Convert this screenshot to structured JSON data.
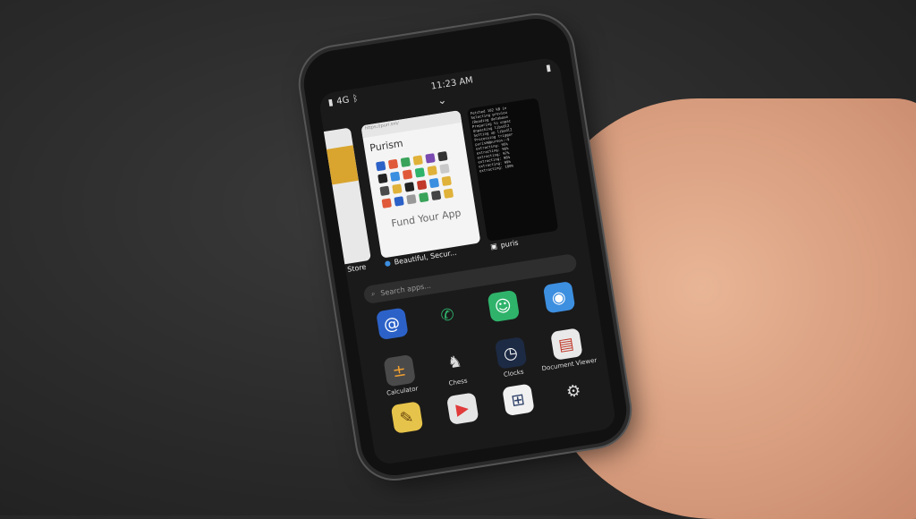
{
  "status": {
    "signal": "4G",
    "time": "11:23 AM"
  },
  "switcher": {
    "left_card_caption": "Store",
    "middle_card": {
      "url": "https://puri.sm/",
      "brand": "Purism",
      "headline": "Fund Your App",
      "title": "Beautiful, Secur..."
    },
    "right_card": {
      "title": "puris",
      "terminal_lines": [
        "Fetched 102 kB in",
        "Selecting previou",
        "(Reading database",
        "Preparing to unpac",
        "Unpacking libsdl2",
        "Setting up libsdl2",
        "Processing trigger",
        "purism@pureos:~$",
        "extracting: 95%",
        "extracting: 96%",
        "extracting: 97%",
        "extracting: 98%",
        "extracting: 99%",
        "extracting: 100%"
      ]
    }
  },
  "search": {
    "placeholder": "Search apps..."
  },
  "apps": [
    {
      "name": "",
      "icon": "contacts-icon",
      "color": "#2c62c8"
    },
    {
      "name": "",
      "icon": "phone-icon",
      "color": "#1a1a1a"
    },
    {
      "name": "",
      "icon": "chat-icon",
      "color": "#2fb36b"
    },
    {
      "name": "",
      "icon": "web-browser-icon",
      "color": "#3d8fe0"
    },
    {
      "name": "Calculator",
      "icon": "calculator-icon",
      "color": "#4a4a4a"
    },
    {
      "name": "Chess",
      "icon": "chess-icon",
      "color": "#1a1a1a"
    },
    {
      "name": "Clocks",
      "icon": "clock-icon",
      "color": "#1d2a44"
    },
    {
      "name": "Document Viewer",
      "icon": "document-viewer-icon",
      "color": "#e9e9e9"
    },
    {
      "name": "",
      "icon": "notes-icon",
      "color": "#e6c34a"
    },
    {
      "name": "",
      "icon": "media-player-icon",
      "color": "#e5e5e5"
    },
    {
      "name": "",
      "icon": "software-store-icon",
      "color": "#f1f1f1"
    },
    {
      "name": "",
      "icon": "settings-icon",
      "color": "#1a1a1a"
    }
  ]
}
